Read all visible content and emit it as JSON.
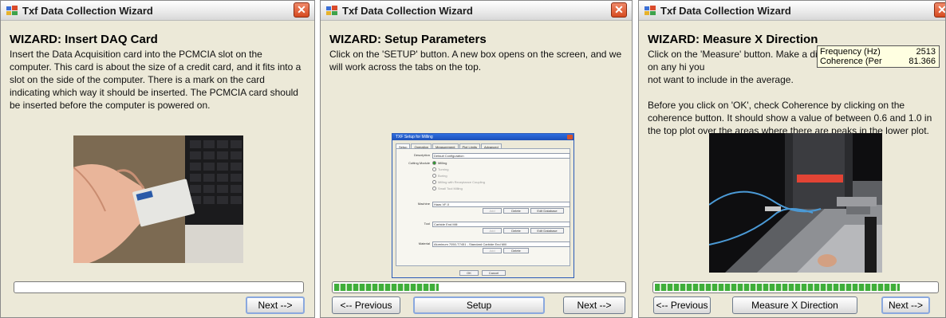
{
  "windows": [
    {
      "title": "Txf Data Collection Wizard",
      "close_glyph": "✕",
      "heading": "WIZARD: Insert DAQ Card",
      "body": "Insert the Data Acquisition card into the PCMCIA slot on the computer.  This card is about the size of a credit card, and it fits into a slot on the side of the computer.  There is a mark on the card indicating which way it should be inserted.  The PCMCIA card should be inserted before the computer is powered on.",
      "progress": 0,
      "buttons": {
        "next": "Next  -->"
      }
    },
    {
      "title": "Txf Data Collection Wizard",
      "close_glyph": "✕",
      "heading": "WIZARD: Setup Parameters",
      "body": "Click on the 'SETUP' button.  A new box opens on the screen, and we will work across the tabs on the top.",
      "progress": 0.36,
      "buttons": {
        "previous": "<-- Previous",
        "setup": "Setup",
        "next": "Next  -->"
      },
      "mini_dialog": {
        "title": "TXF Setup for Milling",
        "tabs": [
          "Setup",
          "Operation",
          "Measurement",
          "Plot Limits",
          "Advanced"
        ],
        "labels": {
          "description": "Description",
          "cutting_mode": "Cutting Module",
          "machine": "Machine",
          "tool": "Tool",
          "material": "Material"
        },
        "values": {
          "description": "Default Configuration",
          "machine": "Haas VF-0",
          "tool": "Carbide End Mill",
          "material": "Aluminum 7050-T7451 - Standard Carbide End Mill"
        },
        "radios": [
          "Milling",
          "Turning",
          "Boring",
          "Milling with Receptance Coupling",
          "Small Tool Milling"
        ],
        "buttons": {
          "add": "Add",
          "delete": "Delete",
          "edit_database": "Edit Database",
          "ok": "OK",
          "cancel": "Cancel"
        }
      }
    },
    {
      "title": "Txf Data Collection Wizard",
      "close_glyph": "✕",
      "heading": "WIZARD: Measure X Direction",
      "body_1": "Click on the 'Measure' button.  Make a                              display shows all hits.  Click on any hi                              you\nnot want to include in the average.",
      "body_2": "Before you click on 'OK', check Coherence by clicking on the coherence button.  It should show a value of between 0.6 and 1.0 in the top plot over the areas where there are peaks in the lower plot.",
      "progress": 0.87,
      "buttons": {
        "previous": "<-- Previous",
        "measure": "Measure X Direction",
        "next": "Next  -->"
      },
      "tooltip": {
        "frequency_label": "Frequency (Hz)",
        "frequency_value": "2513",
        "coherence_label": "Coherence (Per",
        "coherence_value": "81.366"
      }
    }
  ],
  "colors": {
    "window_bg": "#ece9d8",
    "progress_green": "#3fae3a",
    "close_red": "#d64a20",
    "tooltip_bg": "#ffffe1"
  }
}
